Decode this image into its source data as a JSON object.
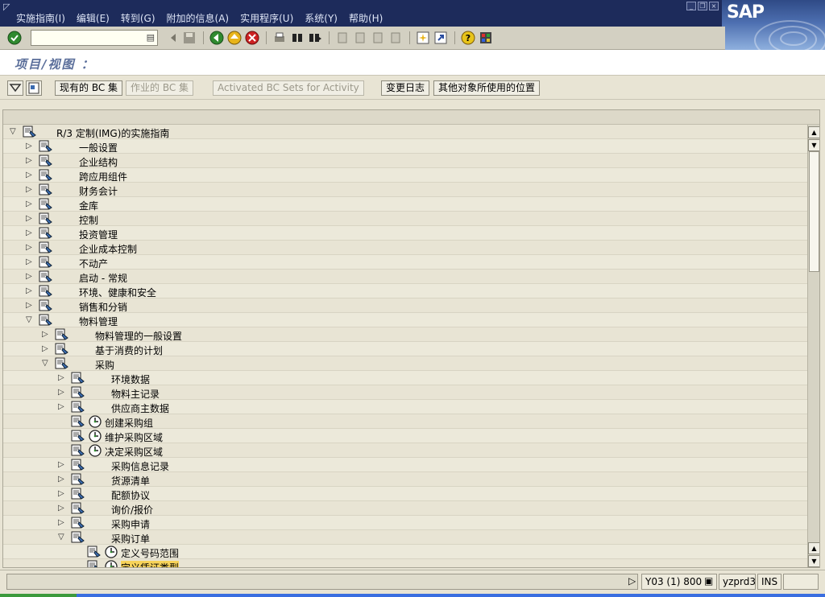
{
  "menubar": {
    "items": [
      "实施指南(I)",
      "编辑(E)",
      "转到(G)",
      "附加的信息(A)",
      "实用程序(U)",
      "系统(Y)",
      "帮助(H)"
    ]
  },
  "logo": {
    "text": "SAP"
  },
  "toolbar": {
    "command_value": ""
  },
  "title": "项目/视图 ：",
  "app_toolbar": {
    "current_bc_set": "现有的 BC 集",
    "activity_bc_set": "作业的 BC 集",
    "activated_bc_sets": "Activated BC Sets for Activity",
    "change_log": "变更日志",
    "where_used": "其他对象所使用的位置"
  },
  "tree": {
    "rows": [
      {
        "level": 0,
        "tw": "open",
        "label": "R/3 定制(IMG)的实施指南",
        "clock": false
      },
      {
        "level": 1,
        "tw": "closed",
        "label": "一般设置",
        "clock": false
      },
      {
        "level": 1,
        "tw": "closed",
        "label": "企业结构",
        "clock": false
      },
      {
        "level": 1,
        "tw": "closed",
        "label": "跨应用组件",
        "clock": false
      },
      {
        "level": 1,
        "tw": "closed",
        "label": "财务会计",
        "clock": false
      },
      {
        "level": 1,
        "tw": "closed",
        "label": "金库",
        "clock": false
      },
      {
        "level": 1,
        "tw": "closed",
        "label": "控制",
        "clock": false
      },
      {
        "level": 1,
        "tw": "closed",
        "label": "投资管理",
        "clock": false
      },
      {
        "level": 1,
        "tw": "closed",
        "label": "企业成本控制",
        "clock": false
      },
      {
        "level": 1,
        "tw": "closed",
        "label": "不动产",
        "clock": false
      },
      {
        "level": 1,
        "tw": "closed",
        "label": "启动 - 常规",
        "clock": false
      },
      {
        "level": 1,
        "tw": "closed",
        "label": "环境、健康和安全",
        "clock": false
      },
      {
        "level": 1,
        "tw": "closed",
        "label": "销售和分销",
        "clock": false
      },
      {
        "level": 1,
        "tw": "open",
        "label": "物料管理",
        "clock": false
      },
      {
        "level": 2,
        "tw": "closed",
        "label": "物料管理的一般设置",
        "clock": false
      },
      {
        "level": 2,
        "tw": "closed",
        "label": "基于消费的计划",
        "clock": false
      },
      {
        "level": 2,
        "tw": "open",
        "label": "采购",
        "clock": false
      },
      {
        "level": 3,
        "tw": "closed",
        "label": "环境数据",
        "clock": false
      },
      {
        "level": 3,
        "tw": "closed",
        "label": "物料主记录",
        "clock": false
      },
      {
        "level": 3,
        "tw": "closed",
        "label": "供应商主数据",
        "clock": false
      },
      {
        "level": 3,
        "tw": "none",
        "label": "创建采购组",
        "clock": true
      },
      {
        "level": 3,
        "tw": "none",
        "label": "维护采购区域",
        "clock": true
      },
      {
        "level": 3,
        "tw": "none",
        "label": "决定采购区域",
        "clock": true
      },
      {
        "level": 3,
        "tw": "closed",
        "label": "采购信息记录",
        "clock": false
      },
      {
        "level": 3,
        "tw": "closed",
        "label": "货源清单",
        "clock": false
      },
      {
        "level": 3,
        "tw": "closed",
        "label": "配额协议",
        "clock": false
      },
      {
        "level": 3,
        "tw": "closed",
        "label": "询价/报价",
        "clock": false
      },
      {
        "level": 3,
        "tw": "closed",
        "label": "采购申请",
        "clock": false
      },
      {
        "level": 3,
        "tw": "open",
        "label": "采购订单",
        "clock": false
      },
      {
        "level": 4,
        "tw": "none",
        "label": "定义号码范围",
        "clock": true
      },
      {
        "level": 4,
        "tw": "none",
        "label": "定义凭证类型",
        "clock": true,
        "selected": true
      }
    ]
  },
  "status": {
    "system": "Y03 (1) 800",
    "server": "yzprd3",
    "mode": "INS"
  },
  "colors": {
    "menubar": "#1d2b5b",
    "background": "#e8e4d4",
    "selection": "#f7d35a"
  }
}
